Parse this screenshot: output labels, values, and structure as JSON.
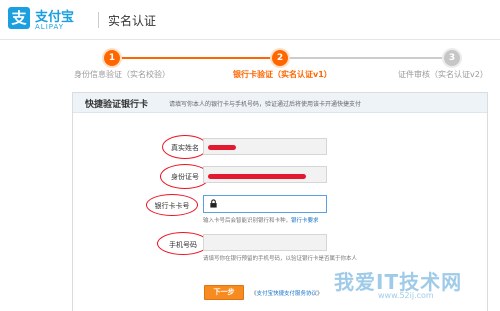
{
  "header": {
    "logo_glyph": "支",
    "logo_cn": "支付宝",
    "logo_en": "ALIPAY",
    "title": "实名认证"
  },
  "steps": [
    {
      "number": "1",
      "label": "身份信息验证（实名校验）",
      "state": "done"
    },
    {
      "number": "2",
      "label": "银行卡验证（实名认证v1）",
      "state": "current"
    },
    {
      "number": "3",
      "label": "证件审核（实名认证v2）",
      "state": "pending"
    }
  ],
  "panel": {
    "title": "快捷验证银行卡",
    "description": "请填写你本人的银行卡与手机号码，验证通过后将使用该卡开通快捷支付"
  },
  "form": {
    "name_label": "真实姓名",
    "id_label": "身份证号",
    "card_label": "银行卡卡号",
    "card_hint": "输入卡号后会智能识别银行和卡种，",
    "card_hint_link": "银行卡要求",
    "phone_label": "手机号码",
    "phone_hint": "请填写你在银行预留的手机号码，以验证银行卡是否属于你本人"
  },
  "actions": {
    "next_label": "下一步",
    "agreement_prefix": "《",
    "agreement_link": "支付宝快捷支付服务协议",
    "agreement_suffix": "》"
  },
  "watermark": {
    "cn": "我爱IT技术网",
    "url": "www.52ij.com"
  },
  "colors": {
    "accent": "#ff6600",
    "brand": "#1a9fe0",
    "highlight": "#e3192f"
  }
}
